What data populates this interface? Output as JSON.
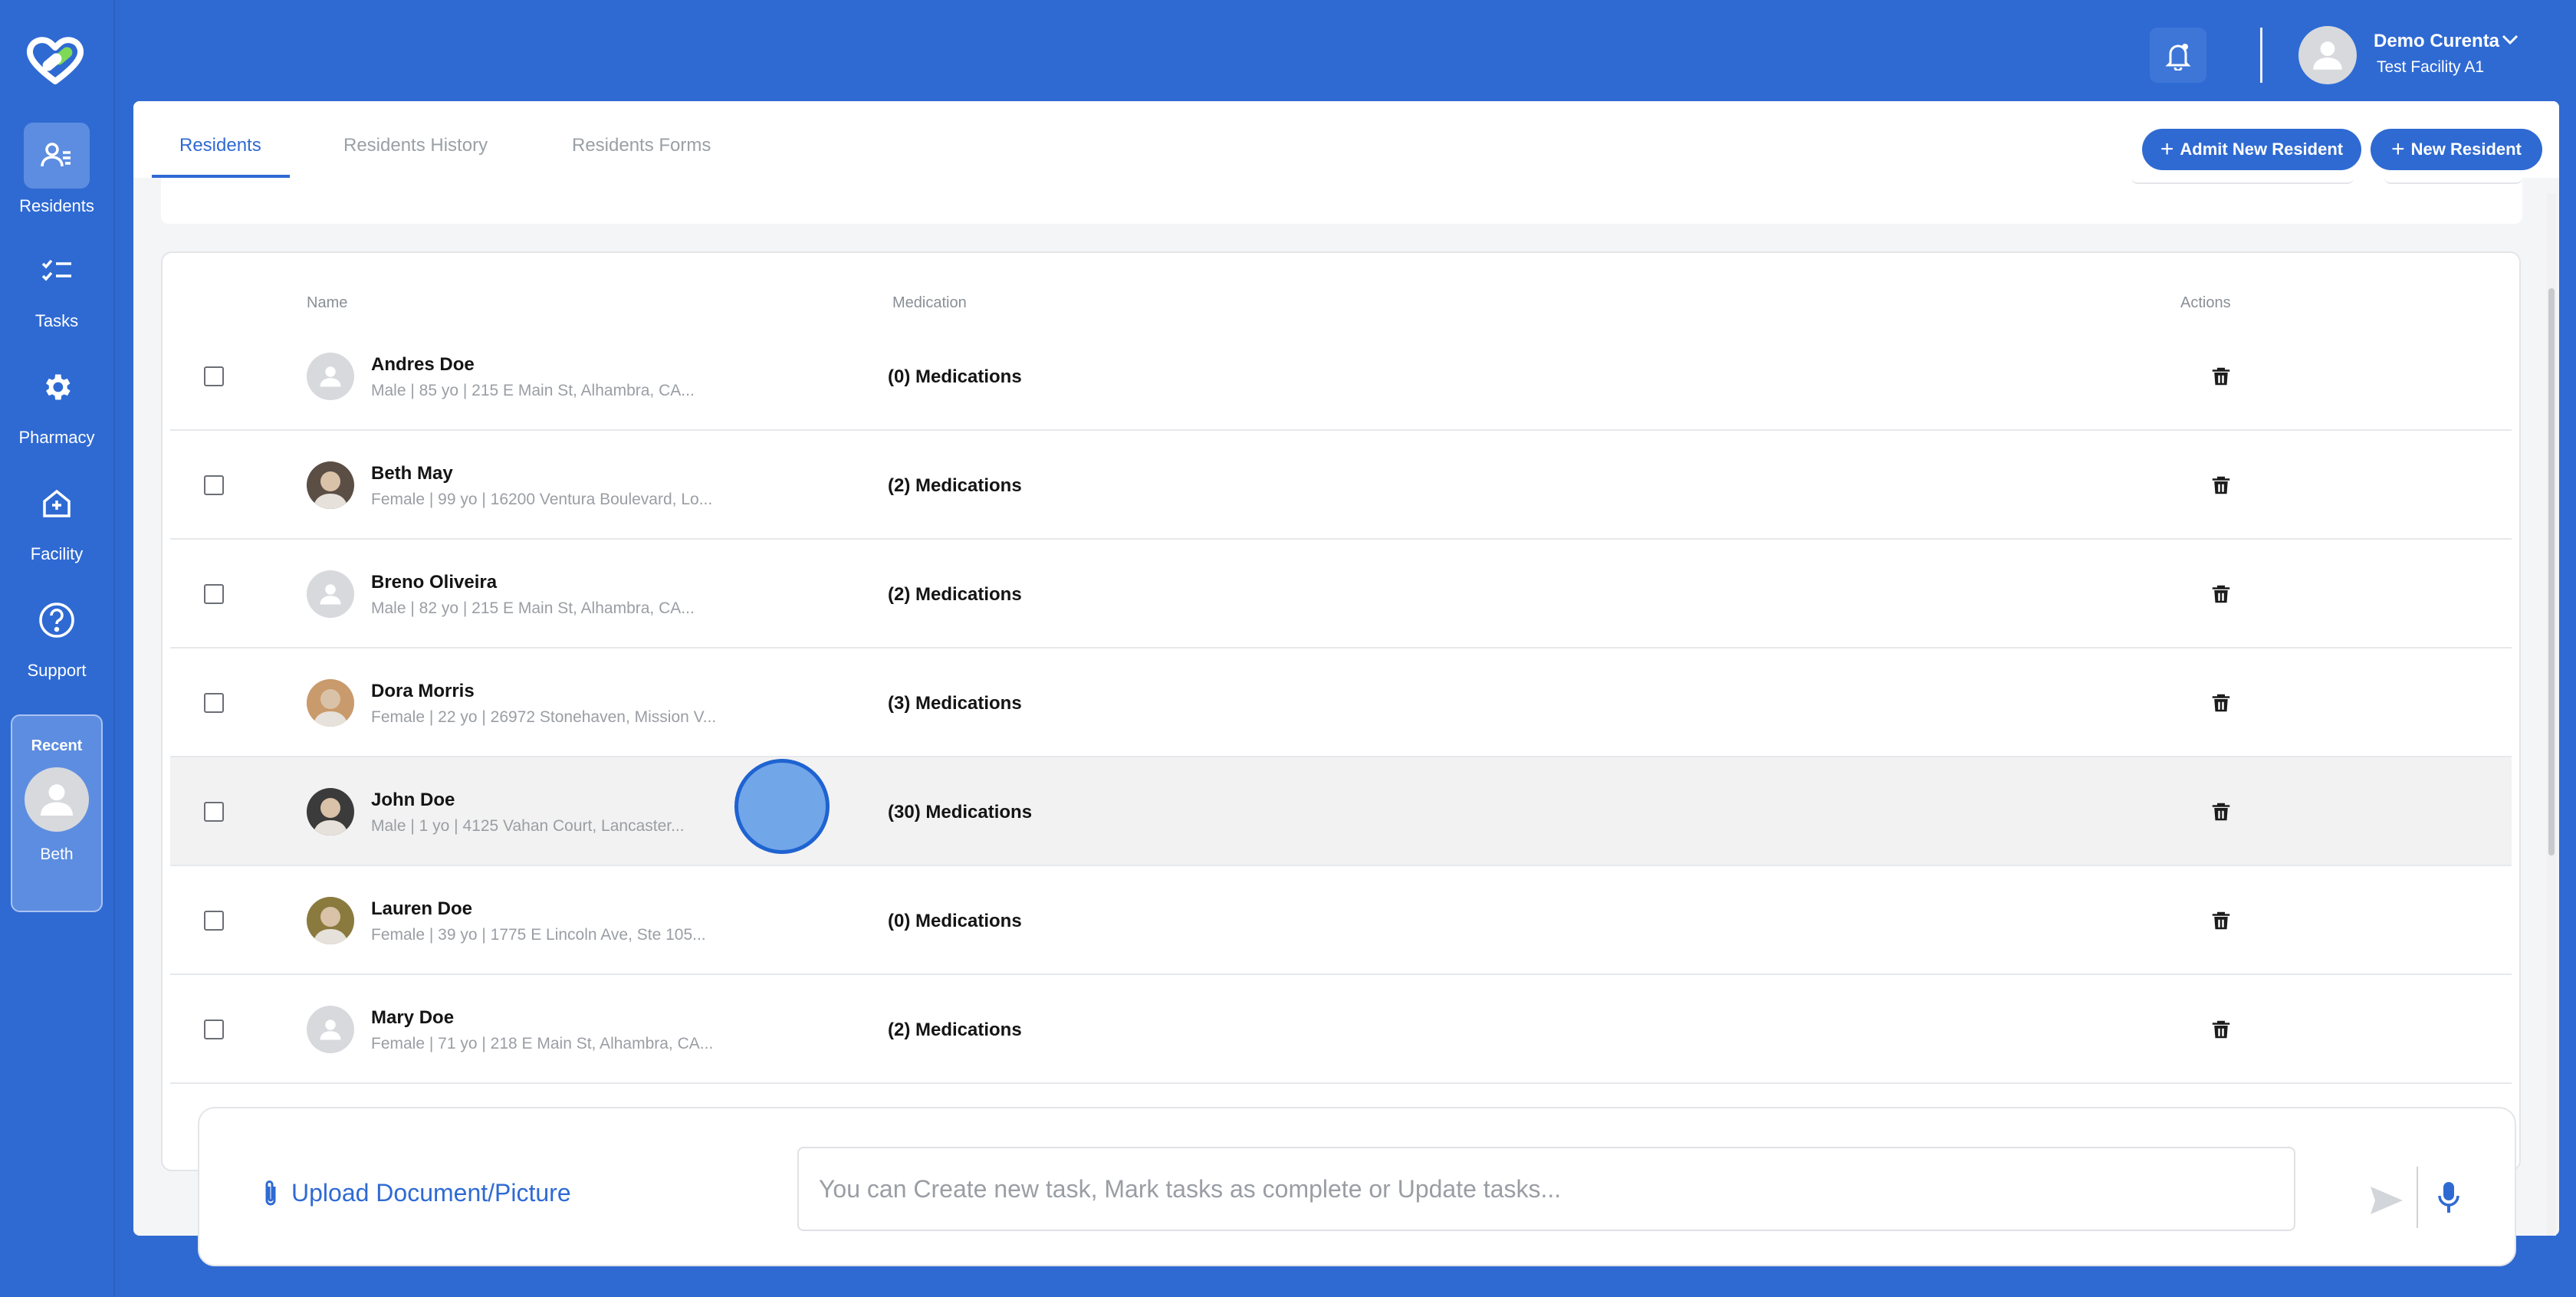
{
  "sidebar": {
    "items": [
      {
        "label": "Residents",
        "icon": "residents-icon"
      },
      {
        "label": "Tasks",
        "icon": "tasks-icon"
      },
      {
        "label": "Pharmacy",
        "icon": "gear-icon"
      },
      {
        "label": "Facility",
        "icon": "facility-icon"
      },
      {
        "label": "Support",
        "icon": "help-icon"
      }
    ],
    "recent": {
      "title": "Recent",
      "name": "Beth"
    }
  },
  "header": {
    "user_name": "Demo Curenta",
    "facility": "Test Facility A1"
  },
  "tabs": [
    {
      "label": "Residents"
    },
    {
      "label": "Residents History"
    },
    {
      "label": "Residents Forms"
    }
  ],
  "actions": {
    "admit": "Admit New Resident",
    "new": "New Resident"
  },
  "table": {
    "headers": {
      "name": "Name",
      "medication": "Medication",
      "actions": "Actions"
    },
    "rows": [
      {
        "name": "Andres Doe",
        "info": "Male | 85 yo | 215 E Main St, Alhambra, CA...",
        "meds": "(0) Medications",
        "photo": false
      },
      {
        "name": "Beth May",
        "info": "Female | 99 yo | 16200 Ventura Boulevard, Lo...",
        "meds": "(2) Medications",
        "photo": true
      },
      {
        "name": "Breno Oliveira",
        "info": "Male | 82 yo | 215 E Main St, Alhambra, CA...",
        "meds": "(2) Medications",
        "photo": false
      },
      {
        "name": "Dora Morris",
        "info": "Female | 22 yo | 26972 Stonehaven, Mission V...",
        "meds": "(3) Medications",
        "photo": true
      },
      {
        "name": "John Doe",
        "info": "Male | 1 yo | 4125 Vahan Court, Lancaster...",
        "meds": "(30) Medications",
        "photo": true
      },
      {
        "name": "Lauren Doe",
        "info": "Female | 39 yo | 1775 E Lincoln Ave, Ste 105...",
        "meds": "(0) Medications",
        "photo": true
      },
      {
        "name": "Mary Doe",
        "info": "Female | 71 yo | 218 E Main St, Alhambra, CA...",
        "meds": "(2) Medications",
        "photo": false
      }
    ]
  },
  "composer": {
    "upload_label": "Upload Document/Picture",
    "placeholder": "You can Create new task, Mark tasks as complete or Update tasks..."
  },
  "colors": {
    "brand": "#2f6ad3",
    "background": "#f4f5f7"
  }
}
